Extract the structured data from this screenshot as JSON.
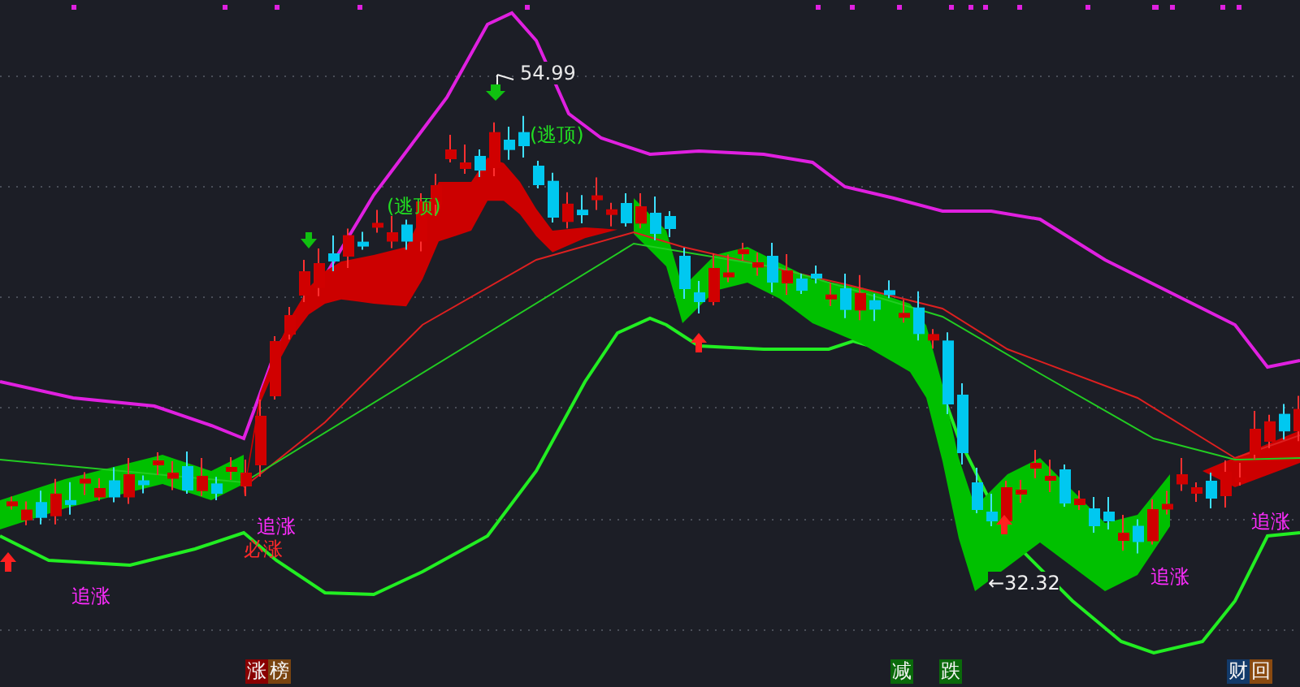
{
  "chart": {
    "price_labels": [
      {
        "kind": "high",
        "text": "54.99"
      },
      {
        "kind": "low",
        "text": "←32.32"
      }
    ],
    "signals": [
      {
        "kind": "escape-top",
        "text": "(逃顶)"
      },
      {
        "kind": "escape-top",
        "text": "(逃顶)"
      },
      {
        "kind": "chase",
        "text": "追涨"
      },
      {
        "kind": "chase",
        "text": "追涨"
      },
      {
        "kind": "must-rise",
        "text": "必涨"
      },
      {
        "kind": "chase",
        "text": "追涨"
      },
      {
        "kind": "chase",
        "text": "追涨"
      }
    ]
  },
  "bottom_markers": [
    {
      "chars": [
        {
          "text": "涨",
          "color": "#8a0000"
        },
        {
          "text": "榜",
          "color": "#7a4410"
        }
      ]
    },
    {
      "chars": [
        {
          "text": "减",
          "color": "#0a6a0a"
        }
      ]
    },
    {
      "chars": [
        {
          "text": "跌",
          "color": "#0a6a0a"
        }
      ]
    },
    {
      "chars": [
        {
          "text": "财",
          "color": "#123a6a"
        },
        {
          "text": "回",
          "color": "#8a4a10"
        }
      ]
    }
  ]
}
